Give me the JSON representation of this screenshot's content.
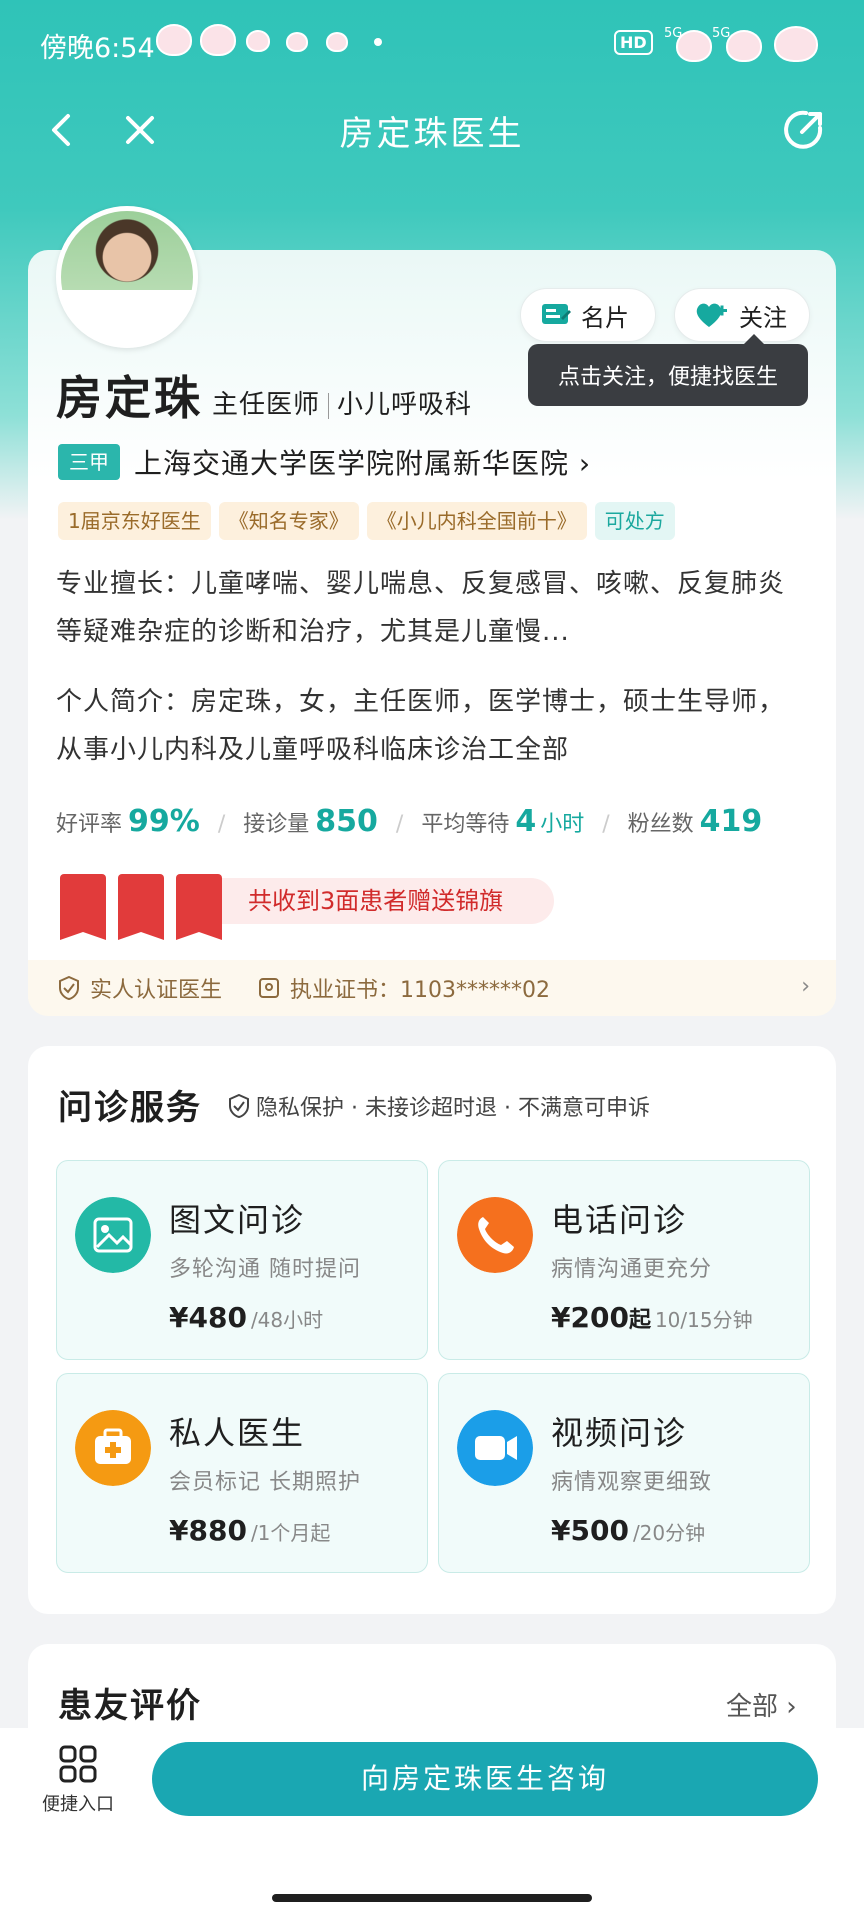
{
  "status": {
    "time": "傍晚6:54",
    "hd": "HD",
    "signal": "5G"
  },
  "nav": {
    "title": "房定珠医生"
  },
  "doctor": {
    "name": "房定珠",
    "title": "主任医师",
    "department": "小儿呼吸科",
    "hospital_tier": "三甲",
    "hospital": "上海交通大学医学院附属新华医院",
    "card_label": "名片",
    "follow_label": "关注",
    "tooltip": "点击关注，便捷找医生",
    "tags": [
      "1届京东好医生",
      "《知名专家》",
      "《小儿内科全国前十》",
      "可处方"
    ],
    "specialty": "专业擅长：儿童哮喘、婴儿喘息、反复感冒、咳嗽、反复肺炎等疑难杂症的诊断和治疗，尤其是儿童慢...",
    "intro": "个人简介：房定珠，女，主任医师，医学博士，硕士生导师，从事小儿内科及儿童呼吸科临床诊治工全部"
  },
  "stats": {
    "rating_label": "好评率",
    "rating": "99%",
    "visits_label": "接诊量",
    "visits": "850",
    "wait_label": "平均等待",
    "wait": "4",
    "wait_unit": "小时",
    "fans_label": "粉丝数",
    "fans": "419"
  },
  "banners_text": "共收到3面患者赠送锦旗",
  "cert": {
    "verified": "实人认证医生",
    "license": "执业证书：1103******02"
  },
  "services": {
    "title": "问诊服务",
    "note": "隐私保护 · 未接诊超时退 · 不满意可申诉",
    "items": [
      {
        "name": "图文问诊",
        "desc": "多轮沟通 随时提问",
        "price": "¥480",
        "unit": "/48小时",
        "color": "#23b9a6"
      },
      {
        "name": "电话问诊",
        "desc": "病情沟通更充分",
        "price": "¥200",
        "qual": "起",
        "unit": "10/15分钟",
        "color": "#f5701e"
      },
      {
        "name": "私人医生",
        "desc": "会员标记 长期照护",
        "price": "¥880",
        "unit": "/1个月起",
        "color": "#f59a12"
      },
      {
        "name": "视频问诊",
        "desc": "病情观察更细致",
        "price": "¥500",
        "unit": "/20分钟",
        "color": "#1b9ee8"
      }
    ]
  },
  "reviews": {
    "title": "患友评价",
    "all": "全部 ›"
  },
  "bottom": {
    "quick_label": "便捷入口",
    "consult_label": "向房定珠医生咨询"
  }
}
